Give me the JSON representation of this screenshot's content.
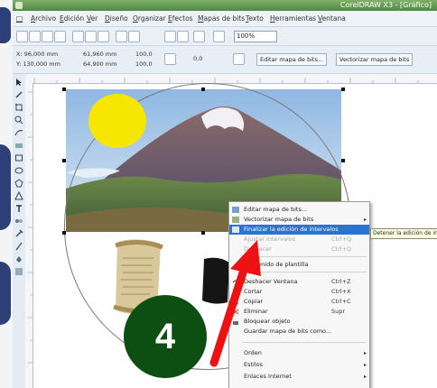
{
  "window": {
    "title": "CorelDRAW X3 - [Gráfico]"
  },
  "menu": [
    {
      "label": "Archivo"
    },
    {
      "label": "Edición"
    },
    {
      "label": "Ver"
    },
    {
      "label": "Diseño"
    },
    {
      "label": "Organizar"
    },
    {
      "label": "Efectos"
    },
    {
      "label": "Mapas de bits"
    },
    {
      "label": "Texto"
    },
    {
      "label": "Herramientas"
    },
    {
      "label": "Ventana"
    }
  ],
  "toolbar": {
    "zoom_value": "100%"
  },
  "property_bar": {
    "x": "X: 96,000 mm",
    "y": "Y: 130,000 mm",
    "w": "61,960 mm",
    "h": "64,900 mm",
    "scale_x": "100,0",
    "scale_y": "100,0",
    "angle": "0,0",
    "edit_bitmap_button": "Editar mapa de bits...",
    "trace_bitmap_button": "Vectorizar mapa de bits"
  },
  "context_menu": {
    "items": [
      {
        "label": "Editar mapa de bits...",
        "shortcut": "",
        "submenu": false,
        "disabled": false,
        "highlighted": false
      },
      {
        "label": "Vectorizar mapa de bits",
        "shortcut": "",
        "submenu": true,
        "disabled": false,
        "highlighted": false
      },
      {
        "label": "Finalizar la edición de intervalos",
        "shortcut": "",
        "submenu": false,
        "disabled": false,
        "highlighted": true
      },
      {
        "label": "Ajustar intervalos",
        "shortcut": "Ctrl+Q",
        "submenu": false,
        "disabled": true,
        "highlighted": false
      },
      {
        "label": "Deshacer",
        "shortcut": "Ctrl+Q",
        "submenu": false,
        "disabled": true,
        "highlighted": false
      },
      {
        "label": "Contenido de plantilla",
        "shortcut": "",
        "submenu": false,
        "disabled": false,
        "highlighted": false
      },
      {
        "label": "Deshacer Ventana",
        "shortcut": "Ctrl+Z",
        "submenu": false,
        "disabled": false,
        "highlighted": false
      },
      {
        "label": "Cortar",
        "shortcut": "Ctrl+X",
        "submenu": false,
        "disabled": false,
        "highlighted": false
      },
      {
        "label": "Copiar",
        "shortcut": "Ctrl+C",
        "submenu": false,
        "disabled": false,
        "highlighted": false
      },
      {
        "label": "Eliminar",
        "shortcut": "Supr",
        "submenu": false,
        "disabled": false,
        "highlighted": false
      },
      {
        "label": "Bloquear objeto",
        "shortcut": "",
        "submenu": false,
        "disabled": false,
        "highlighted": false
      },
      {
        "label": "Guardar mapa de bits como...",
        "shortcut": "",
        "submenu": false,
        "disabled": false,
        "highlighted": false
      },
      {
        "label": "Orden",
        "shortcut": "",
        "submenu": true,
        "disabled": false,
        "highlighted": false
      },
      {
        "label": "Estilos",
        "shortcut": "",
        "submenu": true,
        "disabled": false,
        "highlighted": false
      },
      {
        "label": "Enlaces Internet",
        "shortcut": "",
        "submenu": true,
        "disabled": false,
        "highlighted": false
      }
    ]
  },
  "tooltip": {
    "text": "Detener la edición de intervalos"
  },
  "step_badge": {
    "number": "4"
  },
  "colors": {
    "badge": "#0d4f12",
    "arrow": "#ee1111",
    "highlight": "#2b73d2",
    "sun": "#f6e600"
  }
}
